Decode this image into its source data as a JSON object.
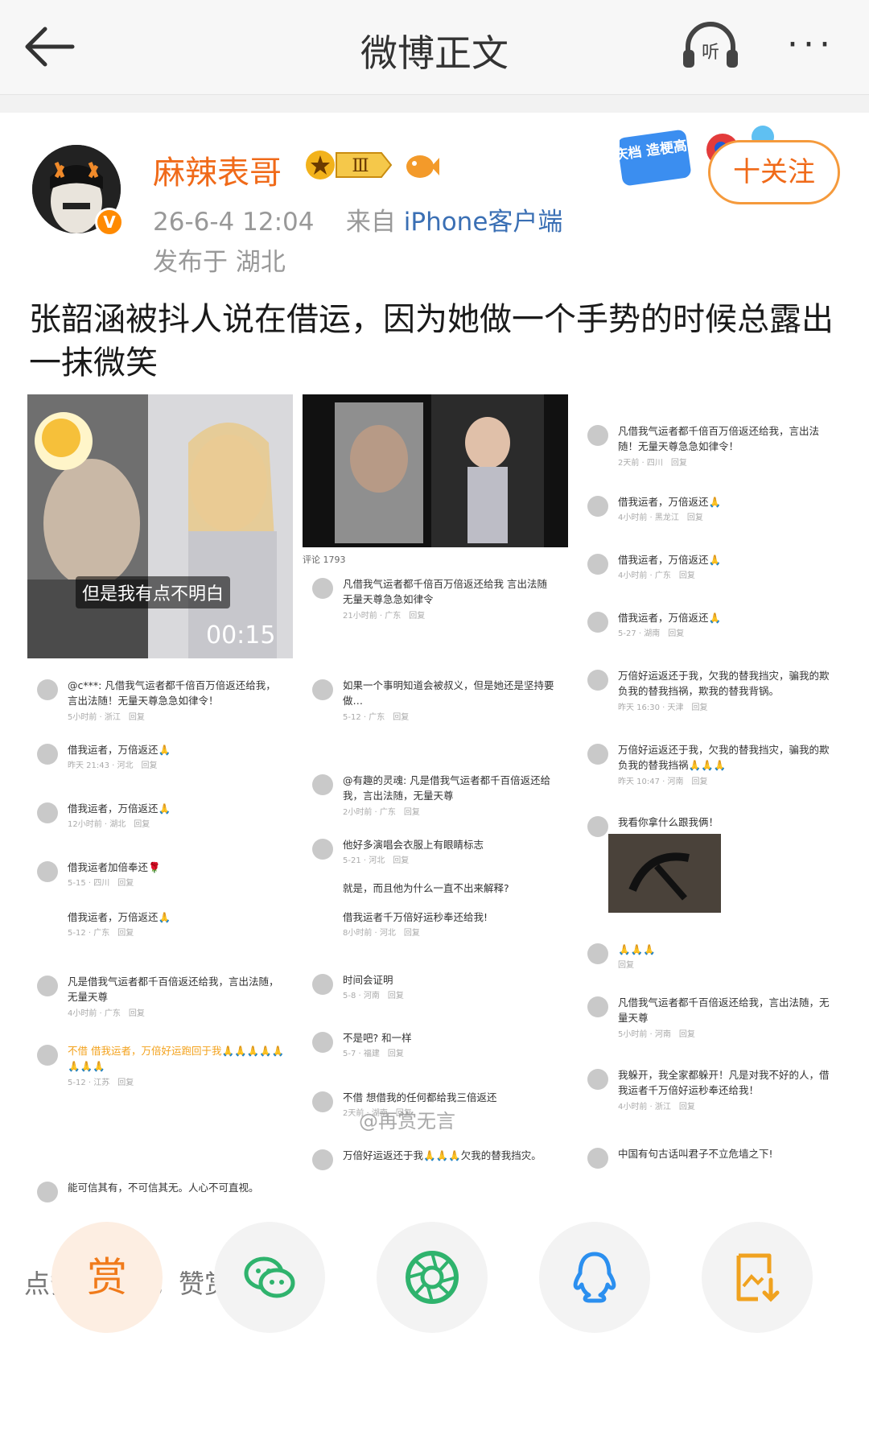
{
  "header": {
    "title": "微博正文",
    "listen_label": "听",
    "more_label": "···"
  },
  "post": {
    "username": "麻辣表哥",
    "vip_level": "Ⅲ",
    "verified_mark": "V",
    "date_time": "26-6-4 12:04",
    "source_prefix": "来自",
    "source": "iPhone客户端",
    "location": "发布于 湖北",
    "follow_label": "十关注",
    "promo_text": "国庆档 造梗高手",
    "text": "张韶涵被抖人说在借运，因为她做一个手势的时候总露出一抹微笑"
  },
  "screenshots": {
    "col1": {
      "subtitle": "但是我有点不明白",
      "duration": "00:15",
      "comments": [
        {
          "text": "@c***: 凡借我气运者都千倍百万倍返还给我，言出法随！无量天尊急急如律令！",
          "meta": "5小时前 · 浙江　回复"
        },
        {
          "text": "借我运者，万倍返还🙏",
          "meta": "昨天 21:43 · 河北　回复"
        },
        {
          "text": "借我运者，万倍返还🙏",
          "meta": "12小时前 · 湖北　回复"
        },
        {
          "text": "借我运者加倍奉还🌹",
          "meta": "5-15 · 四川　回复"
        },
        {
          "text": "借我运者，万倍返还🙏",
          "meta": "5-12 · 广东　回复"
        },
        {
          "text": "凡是借我气运者都千百倍返还给我，言出法随，无量天尊",
          "meta": "4小时前 · 广东　回复"
        },
        {
          "text": "不借 借我运者，万倍好运跑回于我🙏🙏🙏🙏🙏🙏🙏🙏",
          "meta": "5-12 · 江苏　回复"
        },
        {
          "text": "能可信其有，不可信其无。人心不可直视。",
          "meta": ""
        }
      ]
    },
    "col2": {
      "tab_label": "评论 1793",
      "comments": [
        {
          "text": "凡借我气运者都千倍百万倍返还给我 言出法随 无量天尊急急如律令",
          "meta": "21小时前 · 广东　回复"
        },
        {
          "text": "如果一个事明知道会被叔义，但是她还是坚持要做…",
          "meta": "5-12 · 广东　回复"
        },
        {
          "text": "@有趣的灵魂: 凡是借我气运者都千百倍返还给我，言出法随，无量天尊",
          "meta": "2小时前 · 广东　回复"
        },
        {
          "text": "他好多演唱会衣服上有眼睛标志",
          "meta": "5-21 · 河北　回复"
        },
        {
          "text": "就是，而且他为什么一直不出来解释?",
          "meta": ""
        },
        {
          "text": "借我运者千万倍好运秒奉还给我!",
          "meta": "8小时前 · 河北　回复"
        },
        {
          "text": "时间会证明",
          "meta": "5-8 · 河南　回复"
        },
        {
          "text": "不是吧? 和一样",
          "meta": "5-7 · 福建　回复"
        },
        {
          "text": "不借 想借我的任何都给我三倍返还",
          "meta": "2天前 · 湖南　回复"
        },
        {
          "text": "万倍好运返还于我🙏🙏🙏欠我的替我挡灾。",
          "meta": ""
        }
      ]
    },
    "col3": {
      "comments": [
        {
          "text": "凡借我气运者都千倍百万倍返还给我，言出法随！无量天尊急急如律令！",
          "meta": "2天前 · 四川　回复"
        },
        {
          "text": "借我运者，万倍返还🙏",
          "meta": "4小时前 · 黑龙江　回复"
        },
        {
          "text": "借我运者，万倍返还🙏",
          "meta": "4小时前 · 广东　回复"
        },
        {
          "text": "借我运者，万倍返还🙏",
          "meta": "5-27 · 湖南　回复"
        },
        {
          "text": "万倍好运返还于我，欠我的替我挡灾，骗我的欺负我的替我挡祸，欺我的替我背锅。",
          "meta": "昨天 16:30 · 天津　回复"
        },
        {
          "text": "万倍好运返还于我，欠我的替我挡灾，骗我的欺负我的替我挡祸🙏🙏🙏",
          "meta": "昨天 10:47 · 河南　回复"
        },
        {
          "text": "我看你拿什么跟我俩！",
          "meta": ""
        },
        {
          "text": "🙏🙏🙏",
          "meta": "回复"
        },
        {
          "text": "凡借我气运者都千百倍返还给我，言出法随，无量天尊",
          "meta": "5小时前 · 河南　回复"
        },
        {
          "text": "我躲开，我全家都躲开！凡是对我不好的人，借我运者千万倍好运秒奉还给我！",
          "meta": "4小时前 · 浙江　回复"
        },
        {
          "text": "中国有句古话叫君子不立危墙之下!",
          "meta": ""
        }
      ]
    },
    "watermark": "@再赏无言"
  },
  "footer": {
    "praise_text": "点赞是美意，赞赏是鼓励",
    "reward_label": "赏"
  }
}
